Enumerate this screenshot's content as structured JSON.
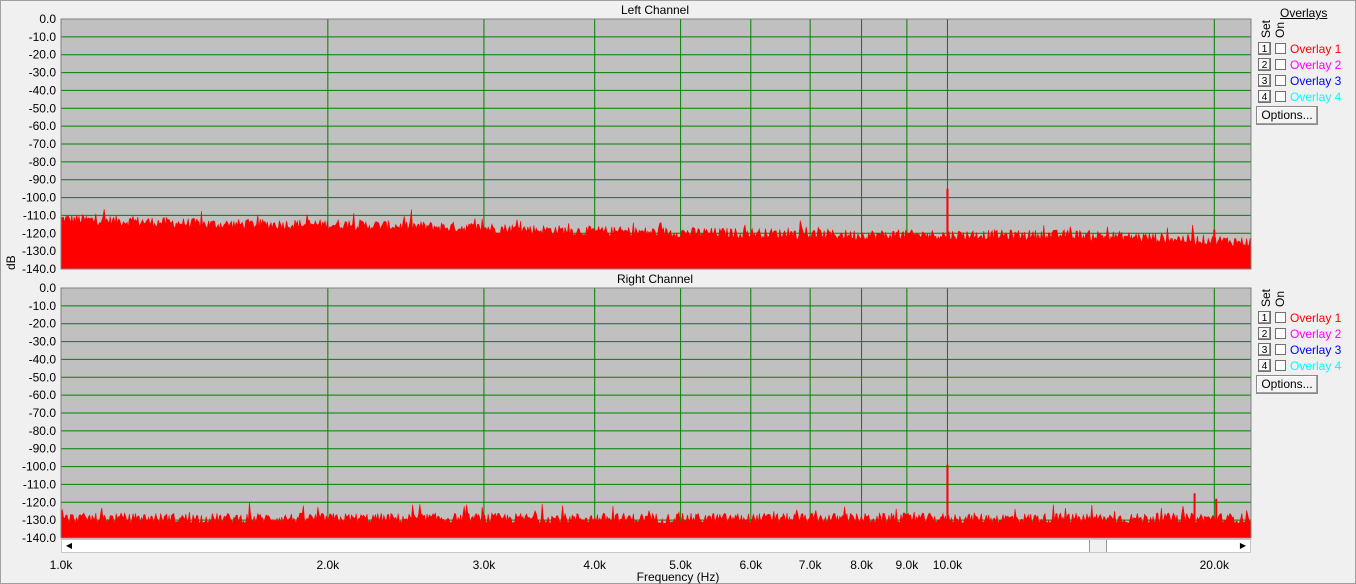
{
  "chart_data": [
    {
      "type": "area",
      "title": "Left Channel",
      "ylabel": "dB",
      "xlabel": "Frequency (Hz)",
      "x_scale": "log",
      "xlim": [
        1000,
        22000
      ],
      "ylim": [
        -140,
        0
      ],
      "grid": true,
      "y_ticks": [
        "0.0",
        "-10.0",
        "-20.0",
        "-30.0",
        "-40.0",
        "-50.0",
        "-60.0",
        "-70.0",
        "-80.0",
        "-90.0",
        "-100.0",
        "-110.0",
        "-120.0",
        "-130.0",
        "-140.0"
      ],
      "series": [
        {
          "color": "#ff0000",
          "noise_floor": {
            "x": [
              1000,
              1500,
              2000,
              3000,
              4000,
              6000,
              8000,
              10000,
              14000,
              16000,
              20000,
              22000
            ],
            "y": [
              -113,
              -116,
              -116,
              -118,
              -120,
              -121,
              -122,
              -122,
              -122,
              -123,
              -125,
              -126
            ]
          },
          "peaks": [
            {
              "x": 10000,
              "y": -95
            },
            {
              "x": 20000,
              "y": -118
            }
          ]
        }
      ]
    },
    {
      "type": "area",
      "title": "Right Channel",
      "ylabel": "dB",
      "xlabel": "Frequency (Hz)",
      "x_scale": "log",
      "xlim": [
        1000,
        22000
      ],
      "ylim": [
        -140,
        0
      ],
      "grid": true,
      "y_ticks": [
        "0.0",
        "-10.0",
        "-20.0",
        "-30.0",
        "-40.0",
        "-50.0",
        "-60.0",
        "-70.0",
        "-80.0",
        "-90.0",
        "-100.0",
        "-110.0",
        "-120.0",
        "-130.0",
        "-140.0"
      ],
      "series": [
        {
          "color": "#ff0000",
          "noise_floor": {
            "x": [
              1000,
              22000
            ],
            "y": [
              -130,
              -130
            ]
          },
          "peaks": [
            {
              "x": 10000,
              "y": -99
            },
            {
              "x": 19000,
              "y": -115
            },
            {
              "x": 20100,
              "y": -118
            }
          ]
        }
      ]
    }
  ],
  "x_ticks": [
    {
      "value": 1000,
      "label": "1.0k"
    },
    {
      "value": 2000,
      "label": "2.0k"
    },
    {
      "value": 3000,
      "label": "3.0k"
    },
    {
      "value": 4000,
      "label": "4.0k"
    },
    {
      "value": 5000,
      "label": "5.0k"
    },
    {
      "value": 6000,
      "label": "6.0k"
    },
    {
      "value": 7000,
      "label": "7.0k"
    },
    {
      "value": 8000,
      "label": "8.0k"
    },
    {
      "value": 9000,
      "label": "9.0k"
    },
    {
      "value": 10000,
      "label": "10.0k"
    },
    {
      "value": 20000,
      "label": "20.0k"
    }
  ],
  "overlays": {
    "title": "Overlays",
    "set_header": "Set",
    "on_header": "On",
    "options_label": "Options...",
    "items": [
      {
        "num": "1",
        "label": "Overlay 1",
        "color": "#ff0000"
      },
      {
        "num": "2",
        "label": "Overlay 2",
        "color": "#ff00ff"
      },
      {
        "num": "3",
        "label": "Overlay 3",
        "color": "#0000ff"
      },
      {
        "num": "4",
        "label": "Overlay 4",
        "color": "#00ffff"
      }
    ]
  },
  "colors": {
    "plot_bg": "#c0c0c0",
    "grid": "#008000",
    "trace": "#ff0000"
  }
}
